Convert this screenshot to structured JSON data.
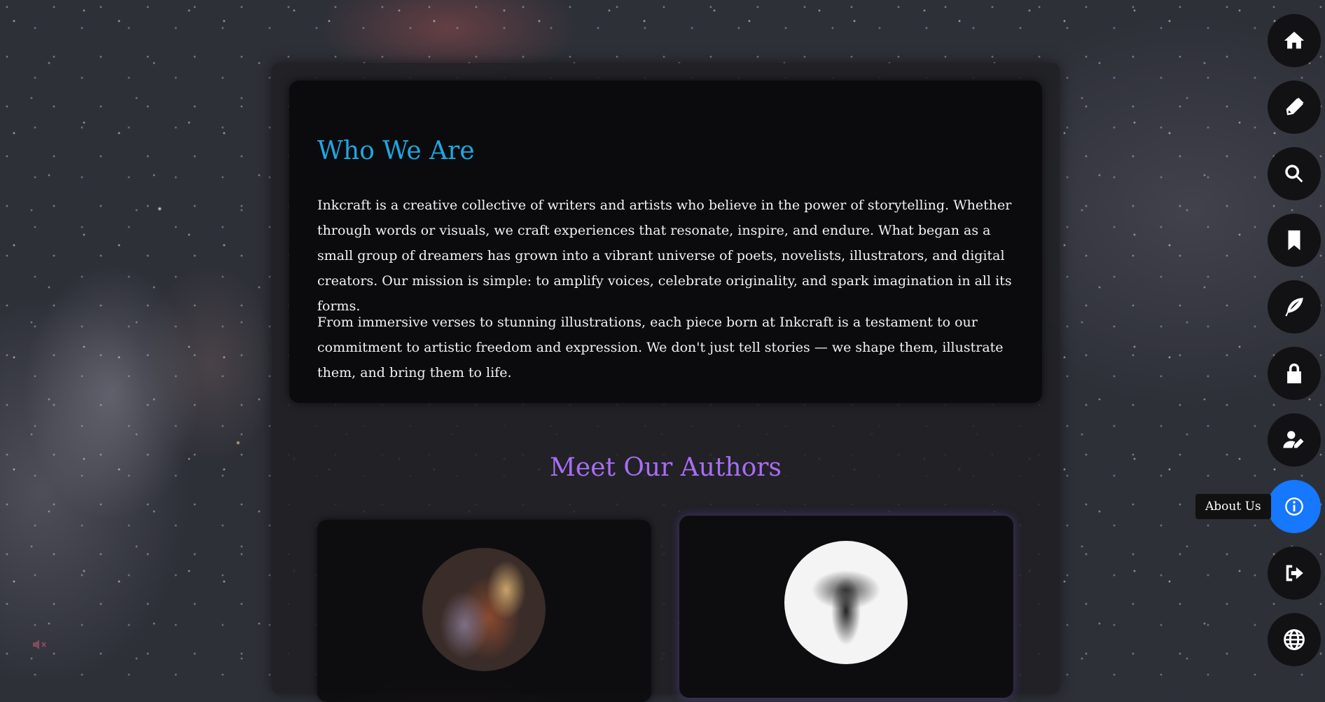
{
  "who_we_are": {
    "title": "Who We Are",
    "paragraph_1": "Inkcraft is a creative collective of writers and artists who believe in the power of storytelling. Whether through words or visuals, we craft experiences that resonate, inspire, and endure. What began as a small group of dreamers has grown into a vibrant universe of poets, novelists, illustrators, and digital creators. Our mission is simple: to amplify voices, celebrate originality, and spark imagination in all its forms.",
    "paragraph_2": "From immersive verses to stunning illustrations, each piece born at Inkcraft is a testament to our commitment to artistic freedom and expression. We don't just tell stories — we shape them, illustrate them, and bring them to life."
  },
  "authors": {
    "title": "Meet Our Authors"
  },
  "sidebar": {
    "items": [
      {
        "icon": "home-icon"
      },
      {
        "icon": "pen-icon"
      },
      {
        "icon": "search-icon"
      },
      {
        "icon": "bookmark-icon"
      },
      {
        "icon": "feather-icon"
      },
      {
        "icon": "lock-icon"
      },
      {
        "icon": "user-edit-icon"
      },
      {
        "icon": "info-icon",
        "label": "About Us",
        "active": true
      },
      {
        "icon": "sign-out-icon"
      },
      {
        "icon": "globe-icon"
      }
    ]
  },
  "colors": {
    "who_title": "#1ea7e0",
    "authors_title": "#a76ef2",
    "active_nav": "#1677ff"
  }
}
